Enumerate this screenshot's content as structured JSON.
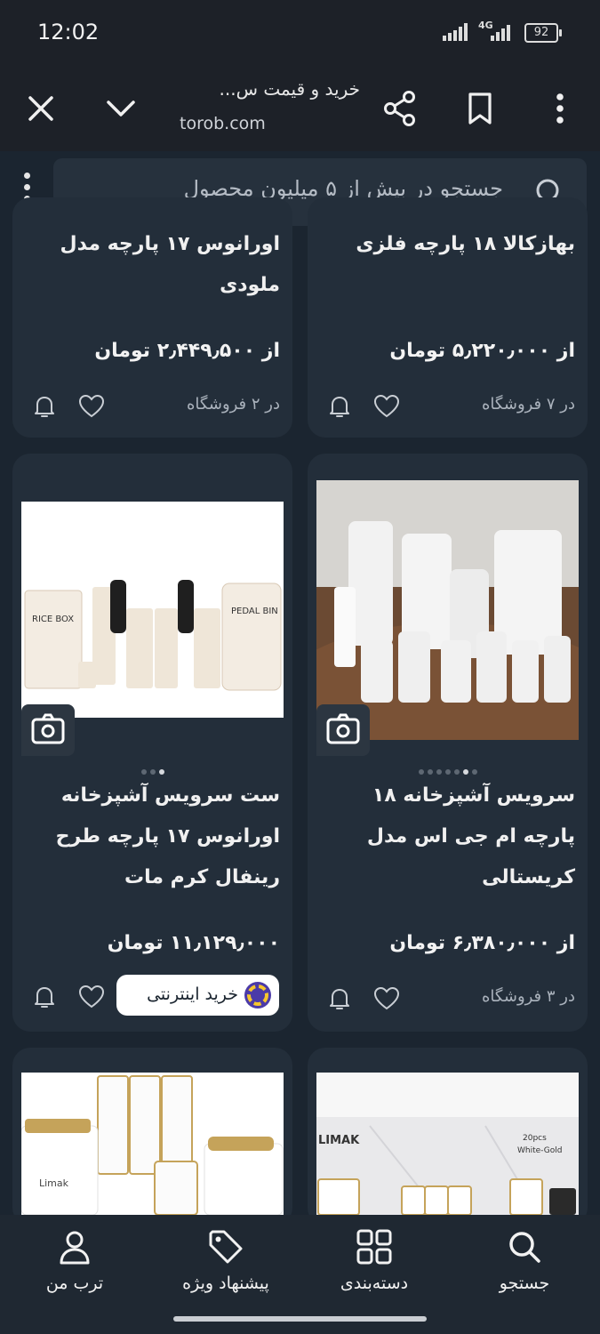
{
  "status_bar": {
    "time": "12:02",
    "network": "4G",
    "battery": "92"
  },
  "toolbar": {
    "title": "خرید و قیمت س...",
    "url": "torob.com"
  },
  "search": {
    "placeholder": "جستجو در بیش از ۵ میلیون محصول"
  },
  "products": [
    {
      "title": "بهازکالا ۱۸ پارچه فلزی",
      "price": "از ۵٫۲۲۰٫۰۰۰ تومان",
      "stores": "در ۷ فروشگاه"
    },
    {
      "title": "اورانوس ۱۷ پارچه مدل ملودی",
      "price": "از ۲٫۴۴۹٫۵۰۰ تومان",
      "stores": "در ۲ فروشگاه"
    },
    {
      "title": "سرویس آشپزخانه ۱۸ پارچه ام جی اس مدل کریستالی",
      "price": "از ۶٫۳۸۰٫۰۰۰ تومان",
      "stores": "در ۳ فروشگاه",
      "image_dots": 7,
      "active_dot": 6
    },
    {
      "title": "ست سرویس آشپزخانه اورانوس ۱۷ پارچه طرح رینفال کرم مات",
      "price": "۱۱٫۱۲۹٫۰۰۰ تومان",
      "badge": "خرید اینترنتی",
      "image_dots": 3,
      "active_dot": 3,
      "image_text": {
        "left": "RICE BOX",
        "right": "PEDAL BIN"
      }
    },
    {
      "image_text": {
        "brand": "LIMAK",
        "pieces": "20pcs",
        "color": "White-Gold"
      }
    },
    {
      "image_text": {
        "brand": "Limak"
      }
    }
  ],
  "bottom_nav": [
    {
      "label": "جستجو"
    },
    {
      "label": "دسته‌بندی"
    },
    {
      "label": "پیشنهاد ویژه"
    },
    {
      "label": "ترب من"
    }
  ],
  "colors": {
    "background": "#1b2530",
    "card": "#232e3a",
    "nav": "#1f2832"
  }
}
